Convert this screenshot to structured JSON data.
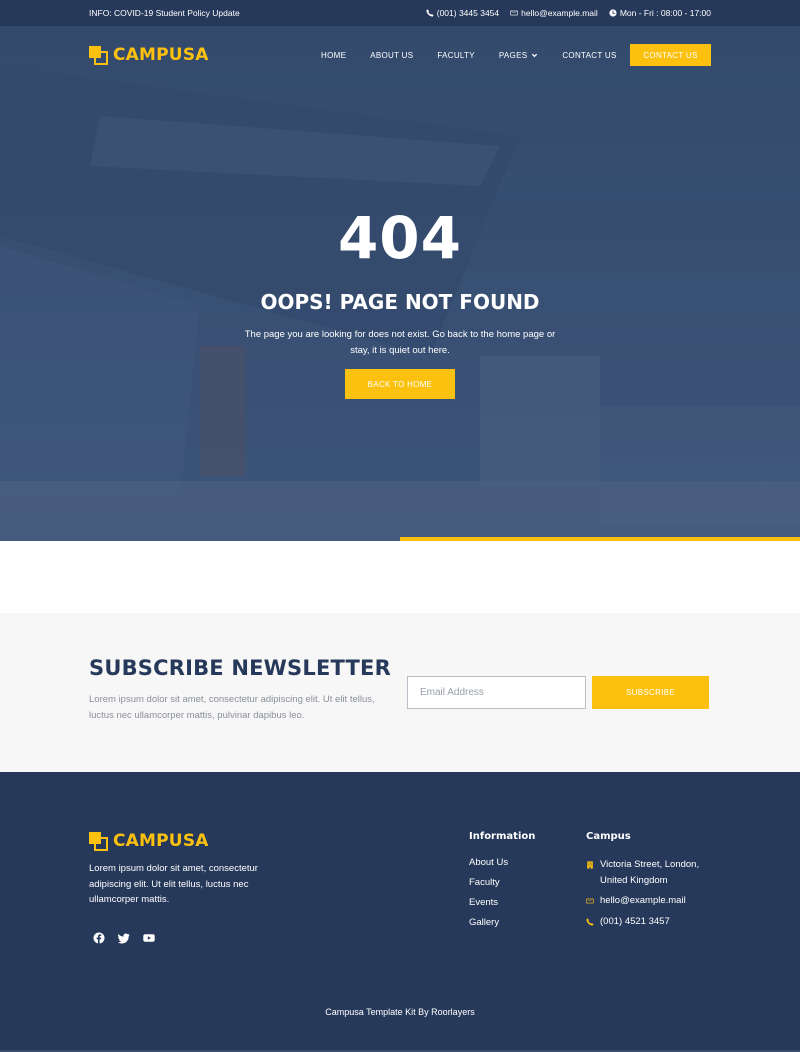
{
  "topbar": {
    "info": "INFO: COVID-19 Student Policy Update",
    "phone": "(001) 3445 3454",
    "email": "hello@example.mail",
    "hours": "Mon - Fri : 08:00 - 17:00"
  },
  "brand": {
    "name": "CAMPUSA"
  },
  "nav": {
    "items": [
      "HOME",
      "ABOUT US",
      "FACULTY",
      "PAGES",
      "CONTACT US"
    ],
    "cta": "CONTACT US"
  },
  "hero": {
    "code": "404",
    "title": "OOPS! PAGE NOT FOUND",
    "description": "The page you are looking for does not exist. Go back to the home page or stay, it is quiet out here.",
    "button": "BACK TO HOME"
  },
  "newsletter": {
    "title": "SUBSCRIBE NEWSLETTER",
    "text": "Lorem ipsum dolor sit amet, consectetur adipiscing elit. Ut elit tellus, luctus nec ullamcorper mattis, pulvinar dapibus leo.",
    "placeholder": "Email Address",
    "button": "SUBSCRIBE"
  },
  "footer": {
    "about": "Lorem ipsum dolor sit amet, consectetur adipiscing elit. Ut elit tellus, luctus nec ullamcorper mattis.",
    "social": [
      "facebook-icon",
      "twitter-icon",
      "youtube-icon"
    ],
    "info_title": "Information",
    "info_links": [
      "About Us",
      "Faculty",
      "Events",
      "Gallery"
    ],
    "campus_title": "Campus",
    "address": "Victoria Street, London, United Kingdom",
    "email": "hello@example.mail",
    "phone": "(001) 4521 3457",
    "copyright": "Campusa Template Kit By Roorlayers"
  },
  "colors": {
    "navy": "#26395a",
    "accent": "#fcc10f"
  }
}
